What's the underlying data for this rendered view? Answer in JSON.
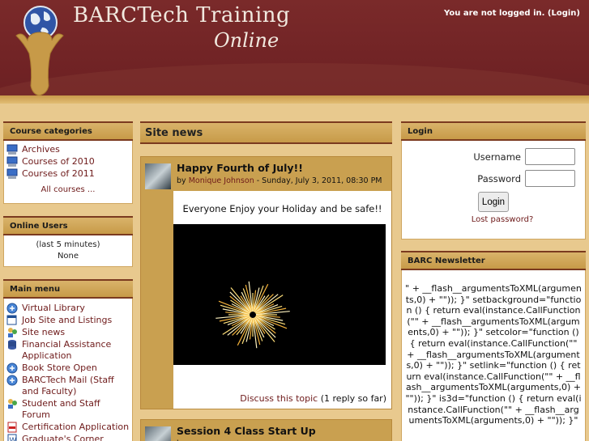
{
  "header": {
    "title_line1": "BARCTech Training",
    "title_line2": "Online",
    "login_status": "You are not logged in. (Login)"
  },
  "course_categories": {
    "heading": "Course categories",
    "items": [
      {
        "label": "Archives",
        "icon": "category-icon"
      },
      {
        "label": "Courses of 2010",
        "icon": "category-icon"
      },
      {
        "label": "Courses of 2011",
        "icon": "category-icon"
      }
    ],
    "all_courses": "All courses ..."
  },
  "online_users": {
    "heading": "Online Users",
    "period": "(last 5 minutes)",
    "value": "None"
  },
  "main_menu": {
    "heading": "Main menu",
    "items": [
      {
        "label": "Virtual Library",
        "icon": "resource-icon"
      },
      {
        "label": "Job Site and Listings",
        "icon": "page-icon"
      },
      {
        "label": "Site news",
        "icon": "forum-icon"
      },
      {
        "label": "Financial Assistance Application",
        "icon": "database-icon"
      },
      {
        "label": "Book Store Open",
        "icon": "resource-icon"
      },
      {
        "label": "BARCTech Mail (Staff and Faculty)",
        "icon": "resource-icon"
      },
      {
        "label": "Student and Staff Forum",
        "icon": "forum-icon"
      },
      {
        "label": "Certification Application",
        "icon": "pdf-icon"
      },
      {
        "label": "Graduate's Corner",
        "icon": "word-icon"
      }
    ]
  },
  "site_news": {
    "heading": "Site news",
    "posts": [
      {
        "title": "Happy Fourth of July!!",
        "by": "by",
        "author": "Monique Johnson",
        "date": " - Sunday, July 3, 2011, 08:30 PM",
        "message": "Everyone Enjoy your Holiday and be safe!!",
        "discuss_link": "Discuss this topic",
        "replies": " (1 reply so far)"
      },
      {
        "title": "Session 4 Class Start Up",
        "by": "by",
        "author": "",
        "date": ""
      }
    ]
  },
  "login_block": {
    "heading": "Login",
    "username_label": "Username",
    "password_label": "Password",
    "button": "Login",
    "lost_password": "Lost password?"
  },
  "newsletter": {
    "heading": "BARC Newsletter",
    "text": "\" + __flash__argumentsToXML(arguments,0) + \"\")); }\" setbackground=\"function () { return eval(instance.CallFunction(\"\" + __flash__argumentsToXML(arguments,0) + \"\")); }\" setcolor=\"function () { return eval(instance.CallFunction(\"\" + __flash__argumentsToXML(arguments,0) + \"\")); }\" setlink=\"function () { return eval(instance.CallFunction(\"\" + __flash__argumentsToXML(arguments,0) + \"\")); }\" is3d=\"function () { return eval(instance.CallFunction(\"\" + __flash__argumentsToXML(arguments,0) + \"\")); }\""
  }
}
